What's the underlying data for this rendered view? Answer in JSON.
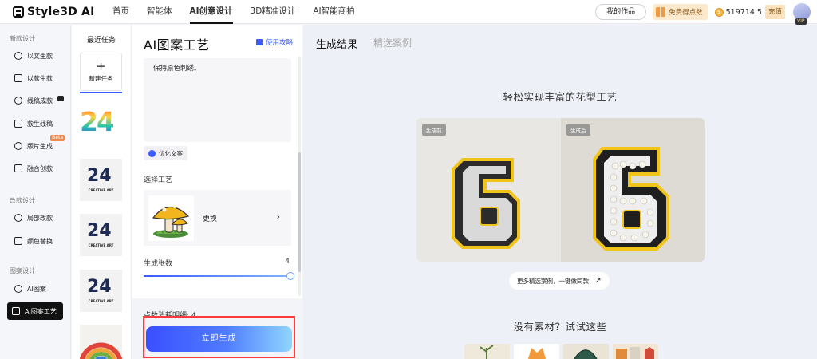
{
  "app": {
    "logo_text": "Style3D AI"
  },
  "nav": {
    "items": [
      "首页",
      "智能体",
      "AI创意设计",
      "3D精准设计",
      "AI智能商拍"
    ],
    "active_index": 2
  },
  "header": {
    "my_works": "我的作品",
    "free_points": "免费得点数",
    "balance": "519714.5",
    "recharge": "充值",
    "vip": "VIP"
  },
  "sidebar": {
    "sections": [
      {
        "title": "新款设计",
        "items": [
          {
            "label": "以文生款",
            "icon": "text-to-design-icon"
          },
          {
            "label": "以款生款",
            "icon": "design-to-design-icon"
          },
          {
            "label": "线稿成款",
            "icon": "sketch-to-design-icon"
          },
          {
            "label": "款生线稿",
            "icon": "design-to-sketch-icon"
          },
          {
            "label": "版片生成",
            "icon": "pattern-piece-icon",
            "badge": "Beta"
          },
          {
            "label": "融合创款",
            "icon": "fusion-design-icon"
          }
        ]
      },
      {
        "title": "改款设计",
        "items": [
          {
            "label": "局部改款",
            "icon": "partial-edit-icon"
          },
          {
            "label": "颜色替换",
            "icon": "color-replace-icon"
          }
        ]
      },
      {
        "title": "图案设计",
        "items": [
          {
            "label": "AI图案",
            "icon": "ai-pattern-icon"
          },
          {
            "label": "AI图案工艺",
            "icon": "ai-pattern-craft-icon",
            "active": true
          }
        ]
      }
    ]
  },
  "recent": {
    "title": "最近任务",
    "new_task": "新建任务",
    "thumbs": [
      {
        "kind": "color",
        "text": "24"
      },
      {
        "kind": "plain",
        "text": "24",
        "sub": "CREATIVE ART"
      },
      {
        "kind": "plain",
        "text": "24",
        "sub": "CREATIVE ART"
      },
      {
        "kind": "plain",
        "text": "24",
        "sub": "CREATIVE ART"
      },
      {
        "kind": "rainbow"
      }
    ]
  },
  "panel": {
    "title": "AI图案工艺",
    "guide": "使用攻略",
    "prompt_text": "保持原色刺绣。",
    "optimize": "优化文案",
    "craft_label": "选择工艺",
    "craft_change": "更换",
    "count_label": "生成张数",
    "count_value": "4",
    "cost_label": "点数消耗明细: 4",
    "generate": "立即生成"
  },
  "main": {
    "tabs": [
      "生成结果",
      "精选案例"
    ],
    "hero_title": "轻松实现丰富的花型工艺",
    "before_tag": "生成前",
    "after_tag": "生成后",
    "more_cases": "更多精选案例，一键做同款",
    "bottom_title": "没有素材？试试这些"
  },
  "colors": {
    "accent": "#3a5bff",
    "highlight_frame": "#ff3b3b",
    "promo_bg": "#fde9cc"
  }
}
